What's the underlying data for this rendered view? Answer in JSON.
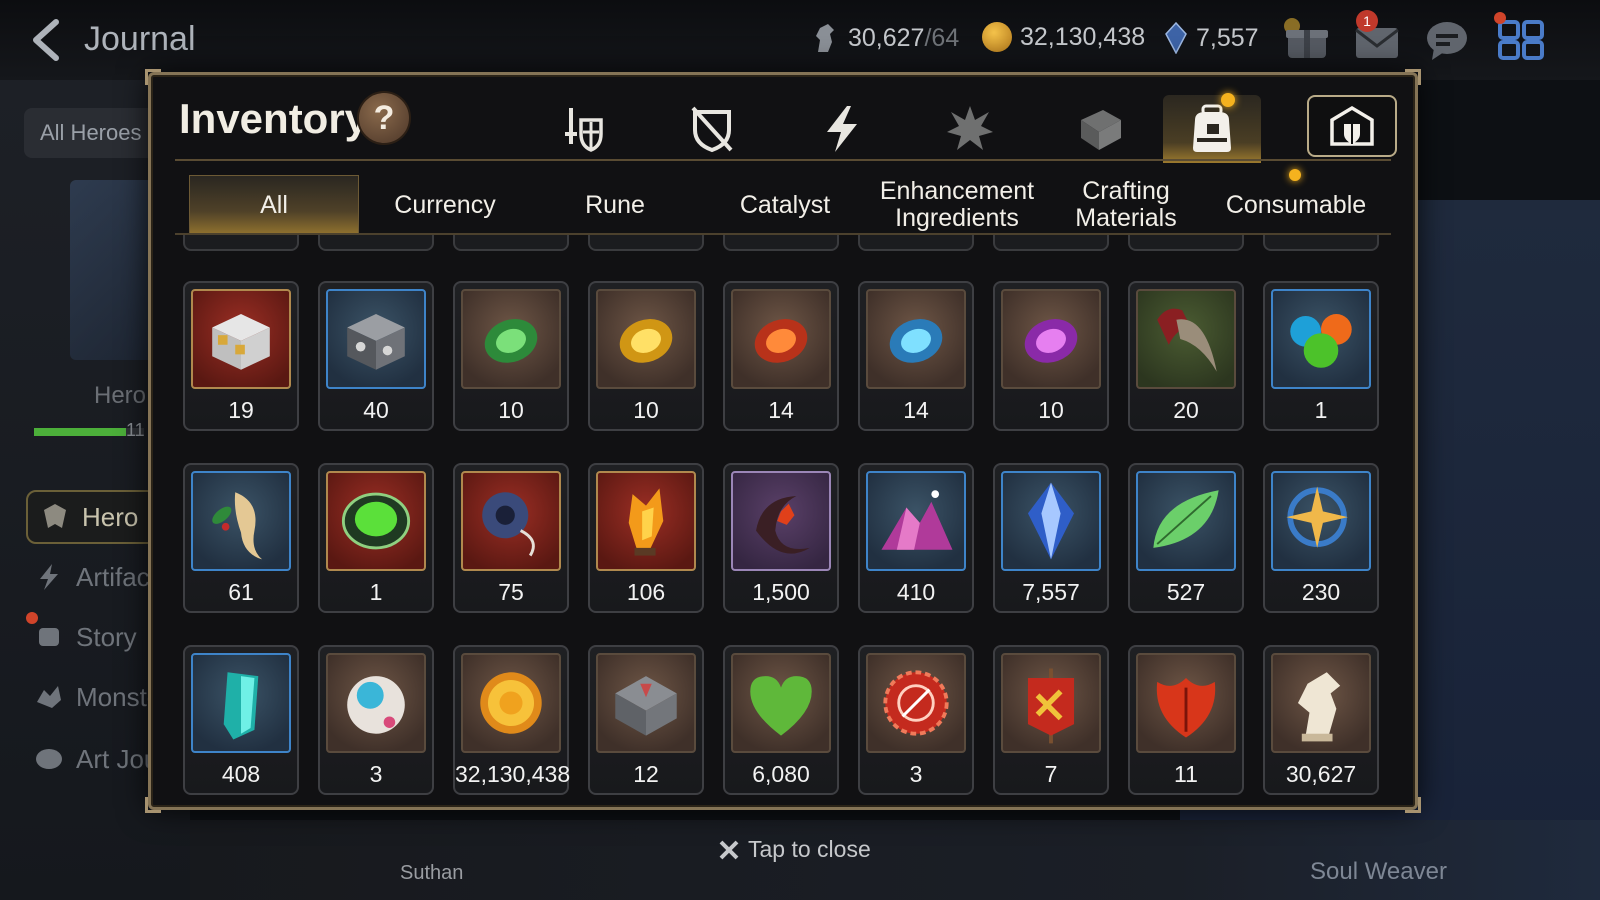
{
  "topbar": {
    "title": "Journal",
    "stamina": "30,627",
    "stamina_cap": "/64",
    "gold": "32,130,438",
    "skystone": "7,557",
    "mail_badge": "1"
  },
  "sidebar": {
    "filter_label": "All Heroes",
    "hero_label": "Hero",
    "level_text": "11",
    "menu": [
      "Hero",
      "Artifact",
      "Story",
      "Monster",
      "Art Journal"
    ]
  },
  "background": {
    "hero_name": "Suthan",
    "right_label": "Soul Weaver"
  },
  "modal": {
    "title": "Inventory",
    "help_label": "?",
    "category_icons": [
      "equipment-icon",
      "shield-icon",
      "artifact-bolt-icon",
      "catalyst-burst-icon",
      "dice-icon",
      "bag-icon",
      "storage-icon"
    ],
    "active_category": "bag-icon",
    "tabs": [
      "All",
      "Currency",
      "Rune",
      "Catalyst",
      "Enhancement Ingredients",
      "Crafting Materials",
      "Consumable"
    ],
    "active_tab": "All"
  },
  "items": [
    {
      "name": "silver-gold-box",
      "qty": "19"
    },
    {
      "name": "silver-box",
      "qty": "40"
    },
    {
      "name": "green-rune",
      "qty": "10"
    },
    {
      "name": "yellow-rune",
      "qty": "10"
    },
    {
      "name": "red-rune",
      "qty": "14"
    },
    {
      "name": "blue-rune",
      "qty": "14"
    },
    {
      "name": "purple-rune",
      "qty": "10"
    },
    {
      "name": "claw-material",
      "qty": "20"
    },
    {
      "name": "slime-orbs",
      "qty": "1"
    },
    {
      "name": "root-herb",
      "qty": "61"
    },
    {
      "name": "green-gem",
      "qty": "1"
    },
    {
      "name": "pendant-ring",
      "qty": "75"
    },
    {
      "name": "flame-crystal",
      "qty": "106"
    },
    {
      "name": "dark-charm",
      "qty": "1,500"
    },
    {
      "name": "pink-crystal-mountain",
      "qty": "410"
    },
    {
      "name": "skystone-crystal",
      "qty": "7,557"
    },
    {
      "name": "green-leaf",
      "qty": "527"
    },
    {
      "name": "star-compass",
      "qty": "230"
    },
    {
      "name": "cyan-crystal",
      "qty": "408"
    },
    {
      "name": "mech-orb",
      "qty": "3"
    },
    {
      "name": "gold-coin",
      "qty": "32,130,438"
    },
    {
      "name": "stone-block",
      "qty": "12"
    },
    {
      "name": "green-heart",
      "qty": "6,080"
    },
    {
      "name": "red-seal",
      "qty": "3"
    },
    {
      "name": "battle-banner",
      "qty": "7"
    },
    {
      "name": "red-leaf",
      "qty": "11"
    },
    {
      "name": "horse-stamina",
      "qty": "30,627"
    }
  ],
  "close_label": "Tap to close"
}
